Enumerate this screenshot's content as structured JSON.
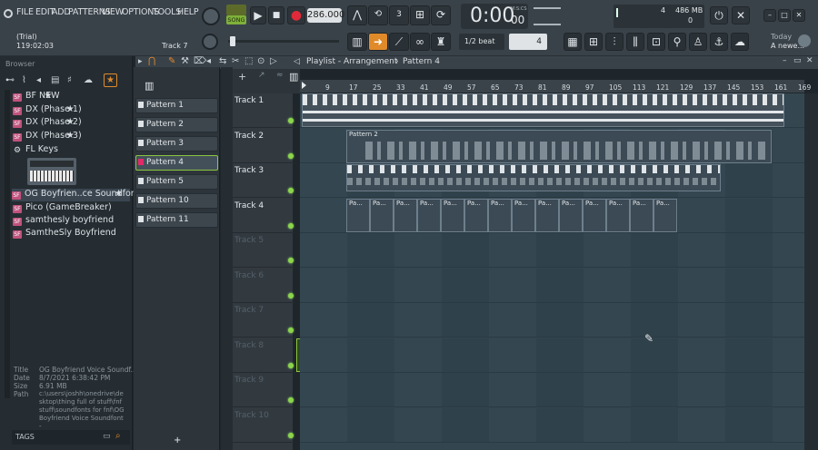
{
  "menu": [
    "FILE",
    "EDIT",
    "ADD",
    "PATTERNS",
    "VIEW",
    "OPTIONS",
    "TOOLS",
    "HELP"
  ],
  "hint": {
    "line1": "(Trial)",
    "line2": "119:02:03",
    "track": "Track 7"
  },
  "transport": {
    "mode": "SONG",
    "tempo": "286.000",
    "time": "0:00",
    "time_sub": "00",
    "time_label": "M:S:CS"
  },
  "monitor": {
    "cpu": "4",
    "mem": "486 MB",
    "voices": "0"
  },
  "snap": "1/2 beat",
  "step": "4",
  "news": {
    "line1": "Today",
    "line2": "A newe..."
  },
  "browser": {
    "title": "Browser",
    "items": [
      {
        "label": "BF NEW",
        "type": "SF"
      },
      {
        "label": "DX (Phase 1)",
        "type": "SF"
      },
      {
        "label": "DX (Phase 2)",
        "type": "SF"
      },
      {
        "label": "DX (Phase 3)",
        "type": "SF"
      },
      {
        "label": "FL Keys",
        "type": "plugin"
      },
      {
        "label": "OG Boyfrien..ce Soundfont",
        "type": "SF"
      },
      {
        "label": "Pico (GameBreaker)",
        "type": "SF"
      },
      {
        "label": "samthesly boyfriend",
        "type": "SF"
      },
      {
        "label": "SamtheSly Boyfriend",
        "type": "SF"
      }
    ],
    "info": {
      "title_k": "Title",
      "title_v": "OG Boyfriend Voice Soundf...",
      "date_k": "Date",
      "date_v": "8/7/2021 6:38:42 PM",
      "size_k": "Size",
      "size_v": "6.91 MB",
      "path_k": "Path",
      "path_v": "c:\\users\\joshh\\onedrive\\desktop\\thing full of stuff\\fnf stuff\\soundfonts for fnf\\OG Boyfriend Voice Soundfont -"
    },
    "tags": "TAGS"
  },
  "playlist": {
    "title": "Playlist - Arrangement",
    "pattern": "Pattern 4",
    "patterns": [
      "Pattern 1",
      "Pattern 2",
      "Pattern 3",
      "Pattern 4",
      "Pattern 5",
      "Pattern 10",
      "Pattern 11"
    ],
    "selected_pattern": 3,
    "ruler": [
      "9",
      "17",
      "25",
      "33",
      "41",
      "49",
      "57",
      "65",
      "73",
      "81",
      "89",
      "97",
      "105",
      "113",
      "121",
      "129",
      "137",
      "145",
      "153",
      "161",
      "169"
    ],
    "tracks": [
      "Track 1",
      "Track 2",
      "Track 3",
      "Track 4",
      "Track 5",
      "Track 6",
      "Track 7",
      "Track 8",
      "Track 9",
      "Track 10"
    ],
    "clip_label_2": "Pattern 2",
    "clip_label_4": "Pa..."
  },
  "colors": {
    "accent_green": "#8cc63e",
    "clip_bg": "#3c4a55"
  }
}
